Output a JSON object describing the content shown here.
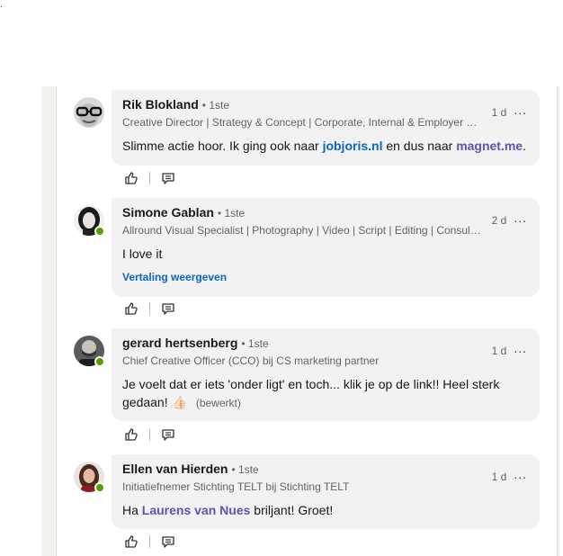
{
  "top_dot": ".",
  "comments": [
    {
      "name": "Rik Blokland",
      "degree": "• 1ste",
      "headline": "Creative Director | Strategy & Concept | Corporate, Internal & Employer Br...",
      "time": "1 d",
      "more_label": "...",
      "text_part1": "Slimme actie hoor. Ik ging ook naar ",
      "link1": "jobjoris.nl",
      "text_part2": " en dus naar ",
      "link2": "magnet.me",
      "text_part3": "."
    },
    {
      "name": "Simone Gablan",
      "degree": "• 1ste",
      "headline": "Allround Visual Specialist | Photography | Video | Script | Editing | Consulti...",
      "time": "2 d",
      "more_label": "...",
      "text": "I love it",
      "translate": "Vertaling weergeven"
    },
    {
      "name": "gerard hertsenberg",
      "degree": "• 1ste",
      "headline": "Chief Creative Officer (CCO) bij CS marketing partner",
      "time": "1 d",
      "more_label": "...",
      "text_line1": "Je voelt dat er iets 'onder ligt' en toch... klik je op de link!! Heel sterk",
      "text_line2": "gedaan!",
      "emoji": "👍🏻",
      "edited": "(bewerkt)"
    },
    {
      "name": "Ellen van Hierden",
      "degree": "• 1ste",
      "headline": "Initiatiefnemer Stichting TELT bij Stichting TELT",
      "time": "1 d",
      "more_label": "...",
      "text_part1": "Ha ",
      "mention": "Laurens van Nues",
      "text_part2": " briljant! Groet!"
    }
  ],
  "icons": {
    "like": "like-thumb-icon",
    "reply": "reply-comment-icon",
    "online": "online-status-dot"
  },
  "colors": {
    "bubble": "#f2f2f2",
    "link": "#0a66c2",
    "mention": "#5e54b1",
    "online": "#57a000"
  }
}
